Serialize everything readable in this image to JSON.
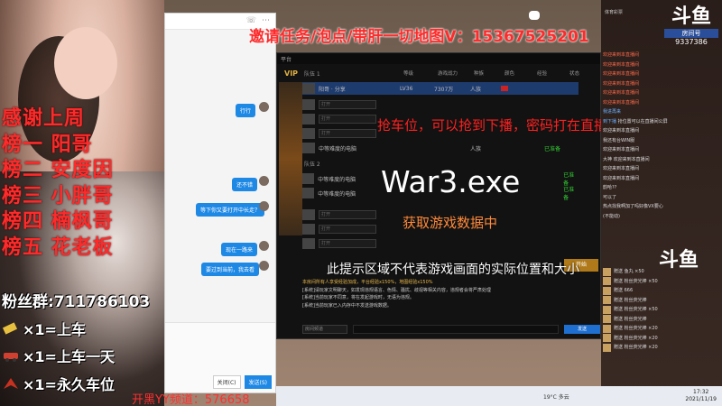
{
  "banner": "邀请任务/泡点/带肝一切地图V：15367525201",
  "left": {
    "honor": [
      "感谢上周",
      "榜一 阳哥",
      "榜二 安度因",
      "榜三 小胖哥",
      "榜四 楠枫哥",
      "榜五 花老板"
    ],
    "fans": "粉丝群:711786103",
    "rules": [
      "×1=上车",
      "×1=上车一天",
      "×1=永久车位"
    ],
    "yy": "开黑YY频道：576658"
  },
  "chat": {
    "bubbles": [
      "行行",
      "还不错",
      "等下你又要打开中长走？",
      "现在一路来",
      "要过到当前，我去看"
    ],
    "buttons": [
      "关闭(C)",
      "发送(S)"
    ]
  },
  "client": {
    "title": "平台",
    "vip": "VIP",
    "team1": "队伍 1",
    "team2": "队伍 2",
    "headers": [
      "等级",
      "游戏战力",
      "种族",
      "颜色",
      "经验",
      "状态"
    ],
    "me": {
      "name": "阳哥 · 分享",
      "level": "LV36",
      "power": "7307万",
      "race": "人族"
    },
    "open_slot": "打开",
    "cpu": "中等难度的电脑",
    "ready": "已准备",
    "start": "开始",
    "log": [
      "本房间所有人享受经验加成，平台经验x150%，地图经验x150%",
      "[系统]请玩家文明聊天，如发现违规语言、色情、骚扰、歧视等相关内容，违规者会将严肃处理",
      "[系统]当前玩家不同意，将在发起游戏时，无语为违规。",
      "[系统]当前玩家已入内存中不发送游戏数据。"
    ],
    "channel": "房间频道",
    "send": "发送"
  },
  "overlay": {
    "grab": "抢车位，可以抢到下播，密码打在直播间公屏",
    "exe": "War3.exe",
    "fetching": "获取游戏数据中",
    "hint": "此提示区域不代表游戏画面的实际位置和大小"
  },
  "right": {
    "room_logo": "斗鱼",
    "room_label": "房间号",
    "room_number": "9337386",
    "tag": "体育彩票",
    "messages": [
      {
        "user": "欢迎来到本直播间",
        "text": ""
      },
      {
        "user": "欢迎来到本直播间",
        "text": ""
      },
      {
        "user": "欢迎来到本直播间",
        "text": ""
      },
      {
        "user": "欢迎来到本直播间",
        "text": ""
      },
      {
        "user": "欢迎来到本直播间",
        "text": ""
      },
      {
        "user": "欢迎来到本直播间",
        "text": ""
      },
      {
        "user": "我进再来",
        "text": ""
      },
      {
        "user": "到下播",
        "text": "抢位置可以在直播间公屏"
      },
      {
        "user": "",
        "text": "欢迎来到本直播间"
      },
      {
        "user": "",
        "text": "我还有台WIN服"
      },
      {
        "user": "",
        "text": "欢迎来到本直播间"
      },
      {
        "user": "",
        "text": "大神 欢迎来到本直播间"
      },
      {
        "user": "",
        "text": "欢迎来到本直播间"
      },
      {
        "user": "",
        "text": "欢迎来到本直播间"
      },
      {
        "user": "",
        "text": "韵哈??"
      },
      {
        "user": "",
        "text": "可以了"
      },
      {
        "user": "",
        "text": "热点找我啊加了吗好像VX要心"
      },
      {
        "user": "",
        "text": "(不能动)"
      }
    ],
    "logo2": "斗鱼",
    "gifts": [
      "赠送 鱼丸 ×50",
      "赠送 粉丝荧光棒 ×50",
      "赠送 666",
      "赠送 粉丝荧光棒",
      "赠送 粉丝荧光棒 ×50",
      "赠送 粉丝荧光棒",
      "赠送 粉丝荧光棒 ×20",
      "赠送 粉丝荧光棒 ×20",
      "赠送 粉丝荧光棒 ×20"
    ]
  },
  "taskbar": {
    "weather": "19°C 多云",
    "time": "17:32",
    "date": "2021/11/19"
  }
}
